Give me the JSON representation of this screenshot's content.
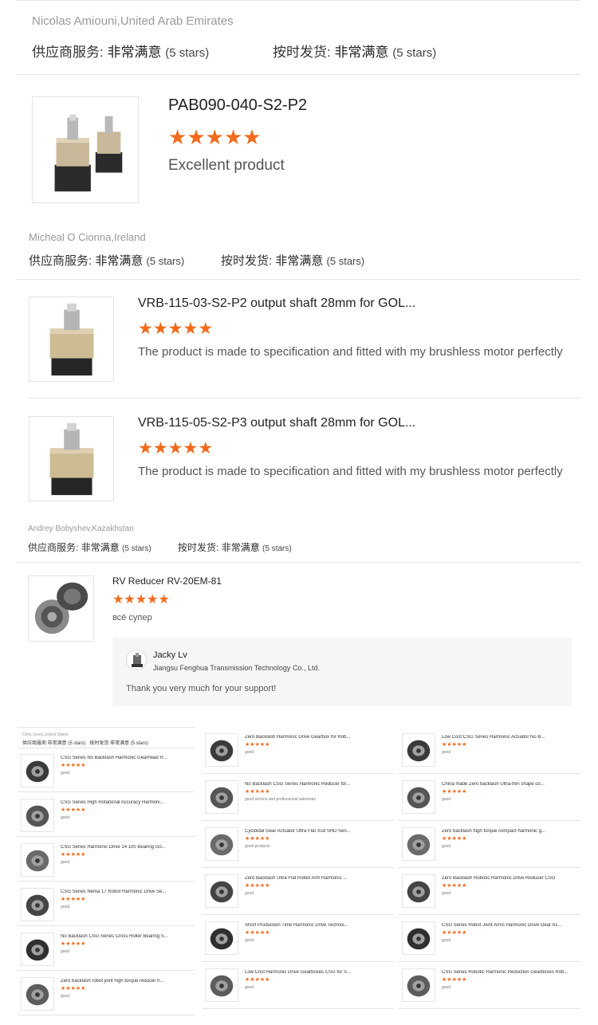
{
  "review1": {
    "reviewer": "Nicolas Amiouni,United Arab Emirates",
    "supplier_label": "供应商服务:",
    "supplier_value": "非常满意",
    "supplier_stars": "(5 stars)",
    "delivery_label": "按时发货:",
    "delivery_value": "非常满意",
    "delivery_stars": "(5 stars)",
    "product_title": "PAB090-040-S2-P2",
    "rating": 5,
    "comment": "Excellent product"
  },
  "review2": {
    "reviewer": "Micheal O Cionna,Ireland",
    "supplier_label": "供应商服务:",
    "supplier_value": "非常满意",
    "supplier_stars": "(5 stars)",
    "delivery_label": "按时发货:",
    "delivery_value": "非常满意",
    "delivery_stars": "(5 stars)",
    "products": [
      {
        "title": "VRB-115-03-S2-P2 output shaft 28mm for GOL...",
        "rating": 5,
        "comment": "The product is made to specification and fitted with my brushless motor perfectly"
      },
      {
        "title": "VRB-115-05-S2-P3 output shaft 28mm for GOL...",
        "rating": 5,
        "comment": "The product is made to specification and fitted with my brushless motor perfectly"
      }
    ]
  },
  "review3": {
    "reviewer": "Andrey Bobyshev,Kazakhstan",
    "supplier_label": "供应商服务:",
    "supplier_value": "非常满意",
    "supplier_stars": "(5 stars)",
    "delivery_label": "按时发货:",
    "delivery_value": "非常满意",
    "delivery_stars": "(5 stars)",
    "product_title": "RV Reducer RV-20EM-81",
    "rating": 5,
    "comment": "всё супер",
    "reply": {
      "name": "Jacky Lv",
      "company": "Jiangsu Fenghua Transmission Technology Co., Ltd.",
      "message": "Thank you very much for your support!"
    }
  },
  "mini": {
    "header": {
      "reviewer": "Chris Jones,United States",
      "supplier_label": "供应商服务:",
      "supplier_value": "非常满意",
      "supplier_stars": "(5 stars)",
      "delivery_label": "按时发货:",
      "delivery_value": "非常满意",
      "delivery_stars": "(5 stars)"
    },
    "columns": [
      [
        {
          "title": "CSG Series No Backlash Harmonic Gearhead R...",
          "text": "good"
        },
        {
          "title": "CSG Series High Rotational Accuracy Harmoni...",
          "text": "good"
        },
        {
          "title": "CSG Series Harmonic Drive 14 100 Bearing Go...",
          "text": "good"
        },
        {
          "title": "CSG Series Nema 17 Robot Harmonic Drive Se...",
          "text": "good"
        },
        {
          "title": "No Backlash CSG Series Cross Roller Bearing S...",
          "text": "good"
        },
        {
          "title": "Zero backlash robot joint high torque reducer h...",
          "text": "good"
        }
      ],
      [
        {
          "title": "Zero Backlash Harmonic Drive Gearbox for Rob...",
          "text": "good"
        },
        {
          "title": "No Backlash CSG Series Harmonic Reducer for...",
          "text": "good service and professional salesman"
        },
        {
          "title": "Cycloidal Gear Actuator Ultra Flat Xsd SHD Seri...",
          "text": "good products"
        },
        {
          "title": "Zero Backlash Ultra Flat Robot Arm Harmonic ...",
          "text": "good"
        },
        {
          "title": "Short Production Time Harmonic Drive Technol...",
          "text": "good"
        },
        {
          "title": "Low Cost Harmonic Drive Gearboxes CSG for S...",
          "text": "good"
        }
      ],
      [
        {
          "title": "Low Cost CSG Series Harmonic Actuator No B...",
          "text": "good"
        },
        {
          "title": "China made Zero backlash Ultra-thin shape co...",
          "text": "good"
        },
        {
          "title": "Zero backlash high torque compact harmonic g...",
          "text": "good"
        },
        {
          "title": "Zero Backlash Robotic Harmonic Drive Reducer CSG",
          "text": "good"
        },
        {
          "title": "CSG Series Robot Joint Arms Harmonic Drive Gear As...",
          "text": "good"
        },
        {
          "title": "CSG Series Robotic Harmonic Reduction Gearboxes Rob...",
          "text": "good"
        }
      ]
    ]
  },
  "colors": {
    "star": "#f26a1b",
    "divider": "#e6e6e6",
    "reply_bg": "#f6f6f6"
  },
  "icons": {
    "star": "star-icon",
    "avatar": "supplier-avatar-icon"
  }
}
